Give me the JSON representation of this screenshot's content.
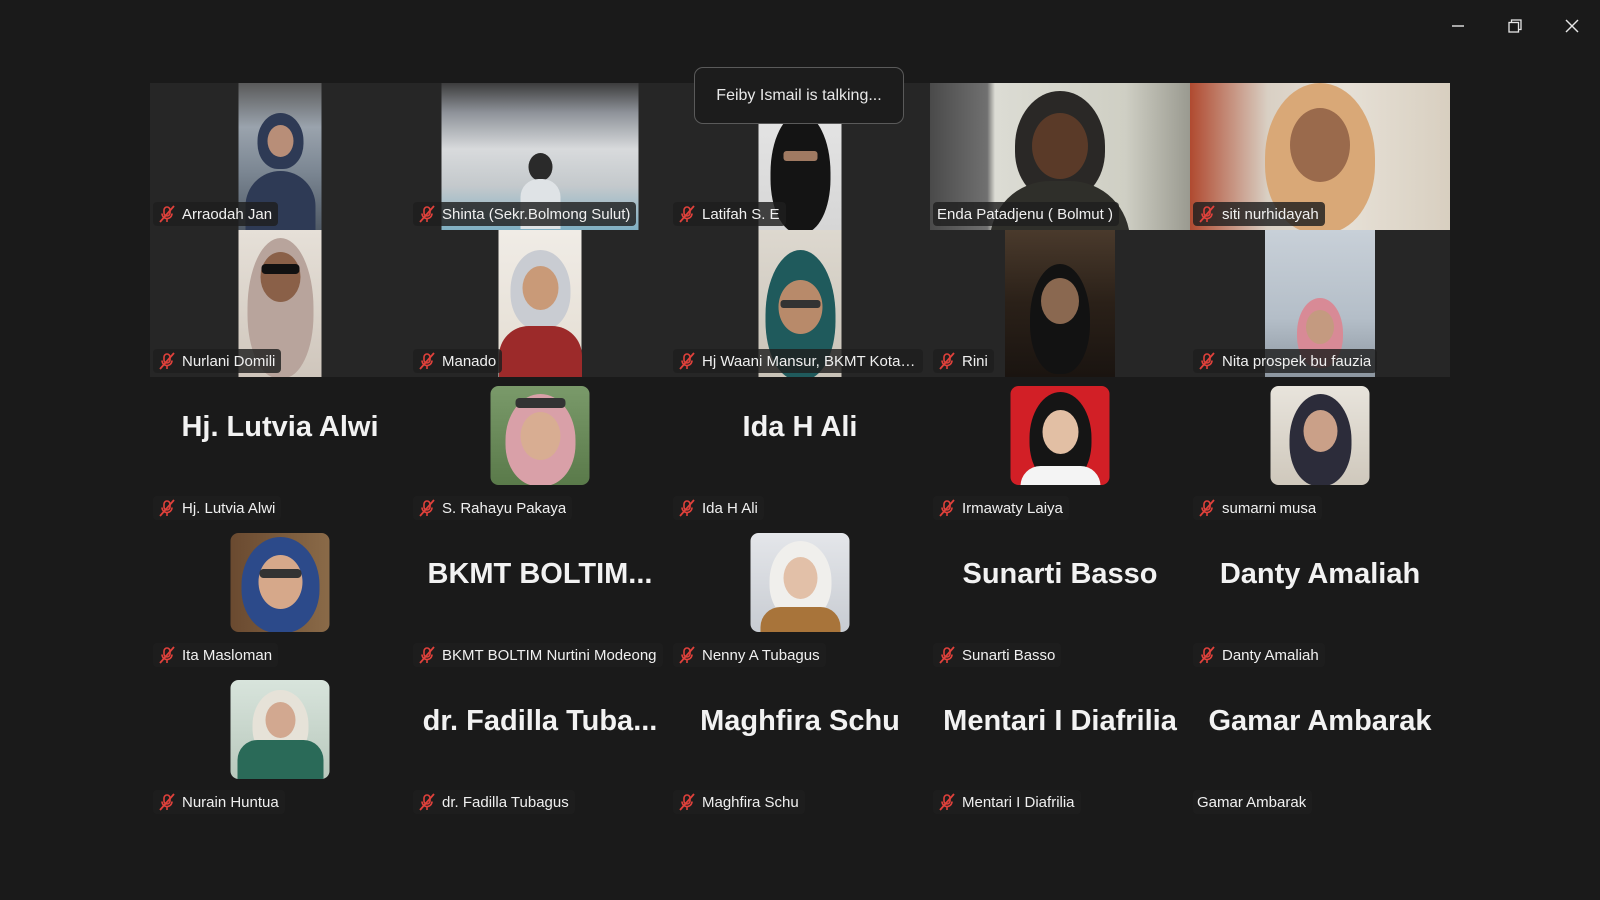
{
  "toast": {
    "text": "Feiby Ismail is talking..."
  },
  "window": {
    "minimize_icon": "minimize-icon",
    "restore_icon": "restore-icon",
    "close_icon": "close-icon"
  },
  "colors": {
    "background": "#1a1a1a",
    "video_tile": "#262626",
    "muted_icon": "#e0413b",
    "nametag_bg": "#1e1e1e"
  },
  "participants": [
    {
      "name": "Arraodah Jan",
      "muted": true,
      "type": "video"
    },
    {
      "name": "Shinta (Sekr.Bolmong Sulut)",
      "muted": true,
      "type": "video"
    },
    {
      "name": "Latifah S. E",
      "muted": true,
      "type": "video"
    },
    {
      "name": "Enda Patadjenu ( Bolmut )",
      "muted": false,
      "type": "video"
    },
    {
      "name": "siti nurhidayah",
      "muted": true,
      "type": "video"
    },
    {
      "name": "Nurlani Domili",
      "muted": true,
      "type": "video"
    },
    {
      "name": "Manado",
      "muted": true,
      "type": "video"
    },
    {
      "name": "Hj Waani Mansur, BKMT Kota B...",
      "muted": true,
      "type": "video"
    },
    {
      "name": "Rini",
      "muted": true,
      "type": "video"
    },
    {
      "name": "Nita prospek bu fauzia",
      "muted": true,
      "type": "video"
    },
    {
      "name": "Hj. Lutvia Alwi",
      "display": "Hj. Lutvia Alwi",
      "muted": true,
      "type": "text"
    },
    {
      "name": "S. Rahayu Pakaya",
      "muted": true,
      "type": "avatar"
    },
    {
      "name": "Ida H Ali",
      "display": "Ida H Ali",
      "muted": true,
      "type": "text"
    },
    {
      "name": "Irmawaty Laiya",
      "muted": true,
      "type": "avatar"
    },
    {
      "name": "sumarni musa",
      "muted": true,
      "type": "avatar"
    },
    {
      "name": "Ita Masloman",
      "muted": true,
      "type": "avatar"
    },
    {
      "name": "BKMT BOLTIM Nurtini Modeong",
      "display": "BKMT  BOLTIM...",
      "muted": true,
      "type": "text"
    },
    {
      "name": "Nenny A Tubagus",
      "muted": true,
      "type": "avatar"
    },
    {
      "name": "Sunarti Basso",
      "display": "Sunarti Basso",
      "muted": true,
      "type": "text"
    },
    {
      "name": "Danty Amaliah",
      "display": "Danty Amaliah",
      "muted": true,
      "type": "text"
    },
    {
      "name": "Nurain Huntua",
      "muted": true,
      "type": "avatar"
    },
    {
      "name": "dr. Fadilla Tubagus",
      "display": "dr.  Fadilla  Tuba...",
      "muted": true,
      "type": "text"
    },
    {
      "name": "Maghfira Schu",
      "display": "Maghfira Schu",
      "muted": true,
      "type": "text"
    },
    {
      "name": "Mentari I Diafrilia",
      "display": "Mentari I Diafrilia",
      "muted": true,
      "type": "text"
    },
    {
      "name": "Gamar Ambarak",
      "display": "Gamar Ambarak",
      "muted": false,
      "type": "text"
    }
  ]
}
